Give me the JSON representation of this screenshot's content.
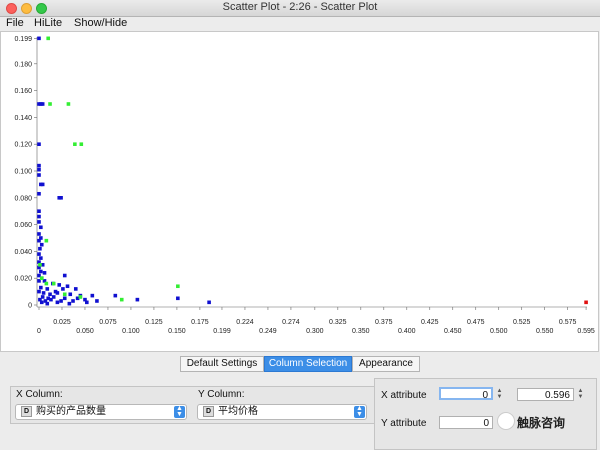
{
  "window": {
    "title": "Scatter Plot - 2:26 - Scatter Plot"
  },
  "menu": [
    "File",
    "HiLite",
    "Show/Hide"
  ],
  "chart_data": {
    "type": "scatter",
    "title": "",
    "xlabel": "",
    "ylabel": "",
    "xlim": [
      0,
      0.596
    ],
    "ylim": [
      0,
      0.2
    ],
    "grid": false,
    "x_ticks": [
      "0",
      "0.025",
      "0.050",
      "0.075",
      "0.100",
      "0.125",
      "0.150",
      "0.175",
      "0.199",
      "0.224",
      "0.249",
      "0.274",
      "0.300",
      "0.325",
      "0.350",
      "0.375",
      "0.400",
      "0.425",
      "0.450",
      "0.475",
      "0.500",
      "0.525",
      "0.550",
      "0.575",
      "0.595"
    ],
    "y_ticks": [
      "0",
      "0.020",
      "0.040",
      "0.060",
      "0.080",
      "0.100",
      "0.120",
      "0.140",
      "0.160",
      "0.180",
      "0.199"
    ],
    "series": [
      {
        "color": "#1010d0",
        "points": [
          [
            0,
            0.199
          ],
          [
            0,
            0.15
          ],
          [
            0.002,
            0.15
          ],
          [
            0.004,
            0.15
          ],
          [
            0,
            0.12
          ],
          [
            0,
            0.104
          ],
          [
            0,
            0.101
          ],
          [
            0,
            0.097
          ],
          [
            0.002,
            0.09
          ],
          [
            0.004,
            0.09
          ],
          [
            0,
            0.083
          ],
          [
            0.022,
            0.08
          ],
          [
            0.024,
            0.08
          ],
          [
            0,
            0.07
          ],
          [
            0,
            0.066
          ],
          [
            0,
            0.062
          ],
          [
            0.002,
            0.058
          ],
          [
            0,
            0.053
          ],
          [
            0.002,
            0.05
          ],
          [
            0,
            0.048
          ],
          [
            0.003,
            0.045
          ],
          [
            0.001,
            0.042
          ],
          [
            0,
            0.038
          ],
          [
            0.002,
            0.035
          ],
          [
            0,
            0.032
          ],
          [
            0.004,
            0.03
          ],
          [
            0,
            0.028
          ],
          [
            0.002,
            0.025
          ],
          [
            0.006,
            0.024
          ],
          [
            0,
            0.022
          ],
          [
            0.003,
            0.02
          ],
          [
            0.028,
            0.022
          ],
          [
            0,
            0.018
          ],
          [
            0.006,
            0.018
          ],
          [
            0.015,
            0.016
          ],
          [
            0.022,
            0.015
          ],
          [
            0.031,
            0.014
          ],
          [
            0.002,
            0.013
          ],
          [
            0.009,
            0.012
          ],
          [
            0.018,
            0.01
          ],
          [
            0.026,
            0.012
          ],
          [
            0.04,
            0.012
          ],
          [
            0,
            0.01
          ],
          [
            0.005,
            0.009
          ],
          [
            0.012,
            0.008
          ],
          [
            0.02,
            0.009
          ],
          [
            0.034,
            0.008
          ],
          [
            0.045,
            0.007
          ],
          [
            0.004,
            0.006
          ],
          [
            0.01,
            0.005
          ],
          [
            0.016,
            0.006
          ],
          [
            0.028,
            0.005
          ],
          [
            0.042,
            0.005
          ],
          [
            0.058,
            0.007
          ],
          [
            0.001,
            0.004
          ],
          [
            0.007,
            0.003
          ],
          [
            0.013,
            0.004
          ],
          [
            0.024,
            0.003
          ],
          [
            0.037,
            0.003
          ],
          [
            0.05,
            0.004
          ],
          [
            0.063,
            0.003
          ],
          [
            0.003,
            0.002
          ],
          [
            0.009,
            0.001
          ],
          [
            0.02,
            0.002
          ],
          [
            0.033,
            0.001
          ],
          [
            0.052,
            0.002
          ],
          [
            0.083,
            0.007
          ],
          [
            0.107,
            0.004
          ],
          [
            0.151,
            0.005
          ],
          [
            0.185,
            0.002
          ]
        ]
      },
      {
        "color": "#33ee33",
        "points": [
          [
            0.01,
            0.199
          ],
          [
            0.012,
            0.15
          ],
          [
            0.032,
            0.15
          ],
          [
            0.039,
            0.12
          ],
          [
            0.046,
            0.12
          ],
          [
            0.008,
            0.048
          ],
          [
            0.001,
            0.03
          ],
          [
            0.003,
            0.02
          ],
          [
            0.008,
            0.016
          ],
          [
            0.016,
            0.016
          ],
          [
            0.028,
            0.008
          ],
          [
            0.045,
            0.006
          ],
          [
            0.09,
            0.004
          ],
          [
            0.151,
            0.014
          ]
        ]
      },
      {
        "color": "#e01010",
        "points": [
          [
            0.595,
            0.002
          ]
        ]
      }
    ]
  },
  "tabs": [
    {
      "label": "Default Settings",
      "active": false
    },
    {
      "label": "Column Selection",
      "active": true
    },
    {
      "label": "Appearance",
      "active": false
    }
  ],
  "settings": {
    "x_column_label": "X Column:",
    "x_column_value": "购买的产品数量",
    "y_column_label": "Y Column:",
    "y_column_value": "平均价格",
    "column_type_badge": "D",
    "x_attribute_label": "X attribute",
    "y_attribute_label": "Y attribute",
    "x_attr_min": "0",
    "x_attr_max": "0.596",
    "y_attr_min": "0"
  },
  "watermark": {
    "text": "触脉咨询"
  }
}
